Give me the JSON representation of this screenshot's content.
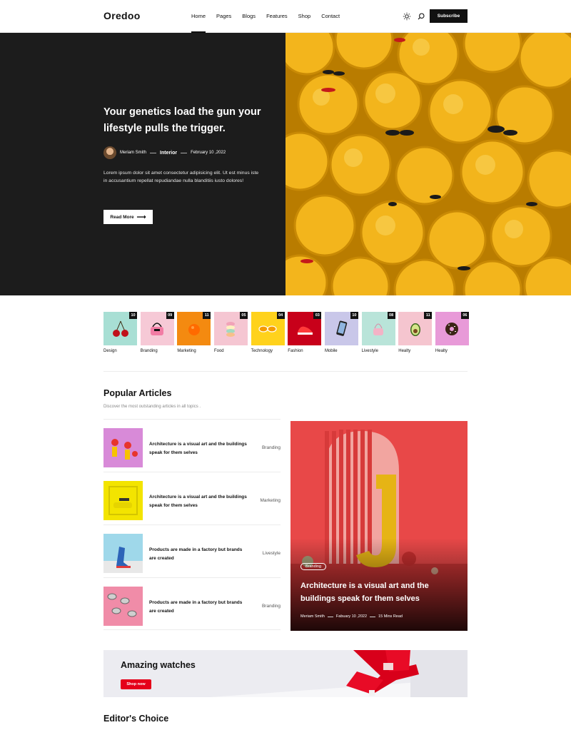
{
  "header": {
    "logo": "Oredoo",
    "nav": [
      "Home",
      "Pages",
      "Blogs",
      "Features",
      "Shop",
      "Contact"
    ],
    "subscribe": "Subscribe"
  },
  "hero": {
    "title": "Your genetics load the gun your lifestyle pulls the trigger.",
    "author": "Meriam Smith",
    "category": "Interior",
    "date": "February 10 ,2022",
    "description": "Lorem ipsum dolor sit amet consectetur adipisicing elit. Ut est minus iste in accusantium repellat repudiandae nulla blanditiis iusto dolores!",
    "button": "Read More"
  },
  "categories": [
    {
      "label": "Design",
      "count": "10"
    },
    {
      "label": "Branding",
      "count": "09"
    },
    {
      "label": "Marketing",
      "count": "11"
    },
    {
      "label": "Food",
      "count": "05"
    },
    {
      "label": "Technology",
      "count": "04"
    },
    {
      "label": "Fashion",
      "count": "03"
    },
    {
      "label": "Mobile",
      "count": "10"
    },
    {
      "label": "Livestyle",
      "count": "08"
    },
    {
      "label": "Healty",
      "count": "11"
    },
    {
      "label": "Healty",
      "count": "06"
    }
  ],
  "popular": {
    "title": "Popular Articles",
    "subtitle": "Discover the most outstanding articles in all topics .",
    "items": [
      {
        "title": "Architecture is a visual art and the buildings speak for them selves",
        "category": "Branding"
      },
      {
        "title": "Architecture is a visual art and the buildings speak for them selves",
        "category": "Marketing"
      },
      {
        "title": "Products are made in a factory but brands are created",
        "category": "Livestyle"
      },
      {
        "title": "Products are made in a factory but brands are created",
        "category": "Branding"
      }
    ],
    "featured": {
      "badge": "Branding",
      "title": "Architecture is a visual art and the buildings speak for them selves",
      "author": "Meriam Smith",
      "date": "Fabuary 10 ,2022",
      "read_time": "15 Mins Read"
    }
  },
  "banner": {
    "title": "Amazing watches",
    "button": "Shop now"
  },
  "editors": {
    "title": "Editor's Choice"
  }
}
